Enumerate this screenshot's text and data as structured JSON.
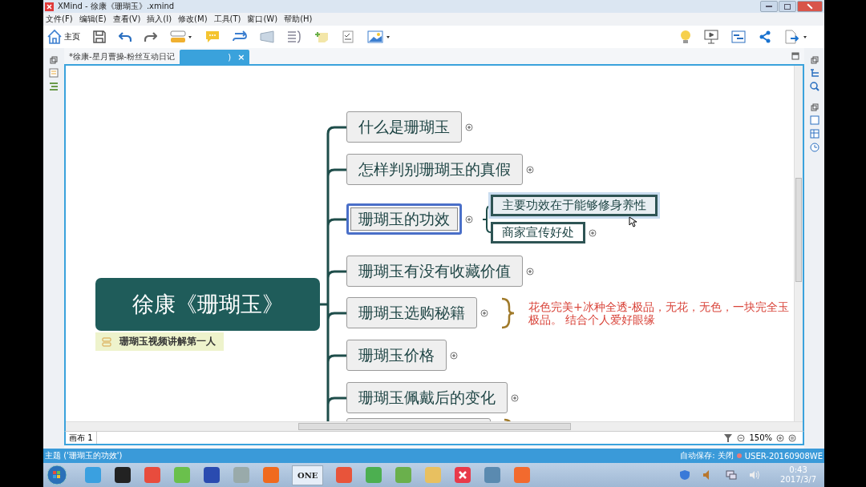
{
  "window": {
    "title": "XMind - 徐康《珊瑚玉》.xmind"
  },
  "menu": [
    "文件(F)",
    "编辑(E)",
    "查看(V)",
    "插入(I)",
    "修改(M)",
    "工具(T)",
    "窗口(W)",
    "帮助(H)"
  ],
  "toolbar": {
    "home_label": "主页"
  },
  "tabs": [
    {
      "label": "*徐康-星月曹操-粉丝互动日记",
      "selected": false
    },
    {
      "label": ")",
      "selected": true,
      "close": "×"
    }
  ],
  "map": {
    "central": {
      "title": "徐康《珊瑚玉》",
      "label": "珊瑚玉视频讲解第一人"
    },
    "topics": [
      {
        "kind": "topic",
        "title": "什么是珊瑚玉",
        "selected": false
      },
      {
        "kind": "topic",
        "title": "怎样判别珊瑚玉的真假",
        "selected": false
      },
      {
        "kind": "topic",
        "title": "珊瑚玉的功效",
        "selected": true,
        "children": [
          {
            "title": "主要功效在于能够修身养性",
            "hovered": true
          },
          {
            "title": "商家宣传好处",
            "hovered": false
          }
        ]
      },
      {
        "kind": "topic",
        "title": "珊瑚玉有没有收藏价值",
        "selected": false
      },
      {
        "kind": "topic",
        "title": "珊瑚玉选购秘籍",
        "selected": false,
        "summary": [
          "花色完美+冰种全透-极品，无花，无色，一块完全玉",
          "极品。 结合个人爱好眼缘"
        ]
      },
      {
        "kind": "topic",
        "title": "珊瑚玉价格",
        "selected": false
      },
      {
        "kind": "topic",
        "title": "珊瑚玉佩戴后的变化",
        "selected": false
      },
      {
        "kind": "cut"
      }
    ]
  },
  "sheet": {
    "label": "画布 1",
    "zoom": "150%"
  },
  "status_bar": {
    "selection": "主题 ('珊瑚玉的功效')",
    "autosave": "自动保存: 关闭",
    "user": "USER-20160908WE"
  },
  "taskbar": {
    "text_button": "ONE",
    "time": "0:43",
    "date": "2017/3/7"
  }
}
